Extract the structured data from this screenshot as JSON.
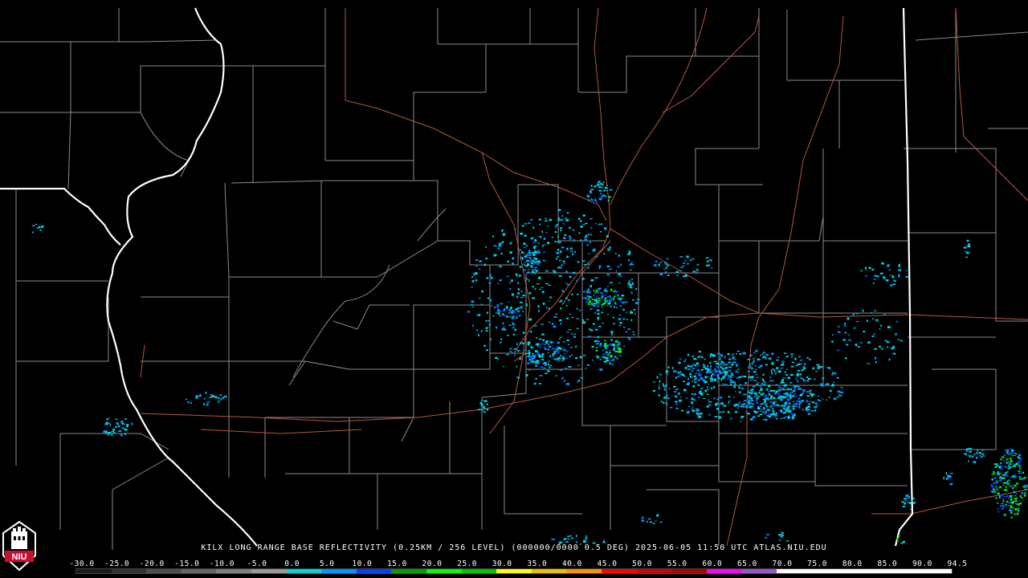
{
  "caption": "KILX LONG RANGE BASE REFLECTIVITY (0.25KM / 256 LEVEL) (000000/0000 0.5 DEG) 2025-06-05 11:50 UTC  ATLAS.NIU.EDU",
  "logo": {
    "text": "NIU",
    "color": "#c8102e"
  },
  "legend": {
    "labels": [
      "-30.0",
      "-25.0",
      "-20.0",
      "-15.0",
      "-10.0",
      "-5.0",
      "0.0",
      "5.0",
      "10.0",
      "15.0",
      "20.0",
      "25.0",
      "30.0",
      "35.0",
      "40.0",
      "45.0",
      "50.0",
      "55.0",
      "60.0",
      "65.0",
      "70.0",
      "75.0",
      "80.0",
      "85.0",
      "90.0",
      "94.5"
    ],
    "colors": [
      "#1a1a1a",
      "#333333",
      "#4d4d4d",
      "#666666",
      "#808080",
      "#999999",
      "#00d8d8",
      "#0096ff",
      "#0040ff",
      "#00a000",
      "#00ff00",
      "#00c800",
      "#ffff00",
      "#e8c000",
      "#ff9000",
      "#ff0000",
      "#d00000",
      "#b00000",
      "#ff00ff",
      "#9955c9",
      "#ffffff",
      "#ffffff",
      "#ffffff",
      "#ffffff",
      "#ffffff"
    ]
  },
  "colors": {
    "state_border": "#ffffff",
    "county_border": "#8c8c8c",
    "highway": "#b4583c",
    "background": "#000000"
  }
}
